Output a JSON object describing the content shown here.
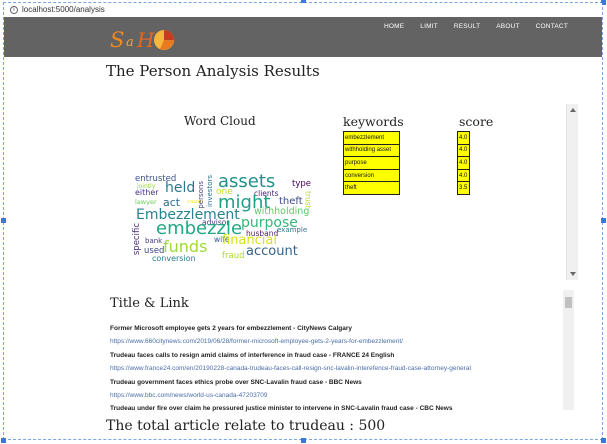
{
  "browser": {
    "url": "localhost:5000/analysis"
  },
  "nav": {
    "items": [
      {
        "label": "HOME"
      },
      {
        "label": "LIMIT"
      },
      {
        "label": "RESULT"
      },
      {
        "label": "ABOUT"
      },
      {
        "label": "CONTACT"
      }
    ]
  },
  "page": {
    "title": "The Person Analysis Results",
    "word_cloud_heading": "Word Cloud",
    "keywords_heading": "keywords",
    "score_heading": "score",
    "title_link_heading": "Title & Link",
    "total_text": "The total article relate to trudeau : 500"
  },
  "keywords": [
    {
      "keyword": "embezzlement",
      "score": "4.0"
    },
    {
      "keyword": "withholding asset",
      "score": "4.0"
    },
    {
      "keyword": "purpose",
      "score": "4.0"
    },
    {
      "keyword": "conversion",
      "score": "4.0"
    },
    {
      "keyword": "theft",
      "score": "3.5"
    }
  ],
  "word_cloud": [
    {
      "text": "entrusted",
      "color": "#3b528b"
    },
    {
      "text": "jointly",
      "color": "#95d840"
    },
    {
      "text": "either",
      "color": "#46337e"
    },
    {
      "text": "lawyer",
      "color": "#6ccd5a"
    },
    {
      "text": "held",
      "color": "#2a788e"
    },
    {
      "text": "act",
      "color": "#31688e"
    },
    {
      "text": "cause",
      "color": "#fde725"
    },
    {
      "text": "persons",
      "color": "#414487"
    },
    {
      "text": "investors",
      "color": "#2c728e"
    },
    {
      "text": "assets",
      "color": "#21918c"
    },
    {
      "text": "one",
      "color": "#c2df23"
    },
    {
      "text": "clients",
      "color": "#482878"
    },
    {
      "text": "type",
      "color": "#440154"
    },
    {
      "text": "theft",
      "color": "#3e4a89"
    },
    {
      "text": "trust",
      "color": "#b5de2b"
    },
    {
      "text": "might",
      "color": "#1f9e89"
    },
    {
      "text": "Embezzlement",
      "color": "#26828e"
    },
    {
      "text": "withholding",
      "color": "#5ec962"
    },
    {
      "text": "advisor",
      "color": "#443a83"
    },
    {
      "text": "purpose",
      "color": "#35b779"
    },
    {
      "text": "specific",
      "color": "#472c7a"
    },
    {
      "text": "embezzle",
      "color": "#22a884"
    },
    {
      "text": "husband",
      "color": "#481f70"
    },
    {
      "text": "example",
      "color": "#297b8e"
    },
    {
      "text": "bank",
      "color": "#453781"
    },
    {
      "text": "wife",
      "color": "#38598c"
    },
    {
      "text": "financial",
      "color": "#d8e219"
    },
    {
      "text": "used",
      "color": "#3f4788"
    },
    {
      "text": "funds",
      "color": "#a0da39"
    },
    {
      "text": "account",
      "color": "#33638d"
    },
    {
      "text": "conversion",
      "color": "#287d8e"
    },
    {
      "text": "fraud",
      "color": "#addc30"
    }
  ],
  "articles": [
    {
      "title": "Former Microsoft employee gets 2 years for embezzlement - CityNews Calgary",
      "link": "https://www.660citynews.com/2019/06/28/former-microsoft-employee-gets-2-years-for-embezzlement/"
    },
    {
      "title": "Trudeau faces calls to resign amid claims of interference in fraud case - FRANCE 24 English",
      "link": "https://www.france24.com/en/20190228-canada-trudeau-faces-call-resign-snc-lavalin-interefence-fraud-case-attorney-general"
    },
    {
      "title": "Trudeau government faces ethics probe over SNC-Lavalin fraud case - BBC News",
      "link": "https://www.bbc.com/news/world-us-canada-47203709"
    },
    {
      "title": "Trudeau under fire over claim he pressured justice minister to intervene in SNC-Lavalin fraud case - CBC News",
      "link": ""
    }
  ]
}
